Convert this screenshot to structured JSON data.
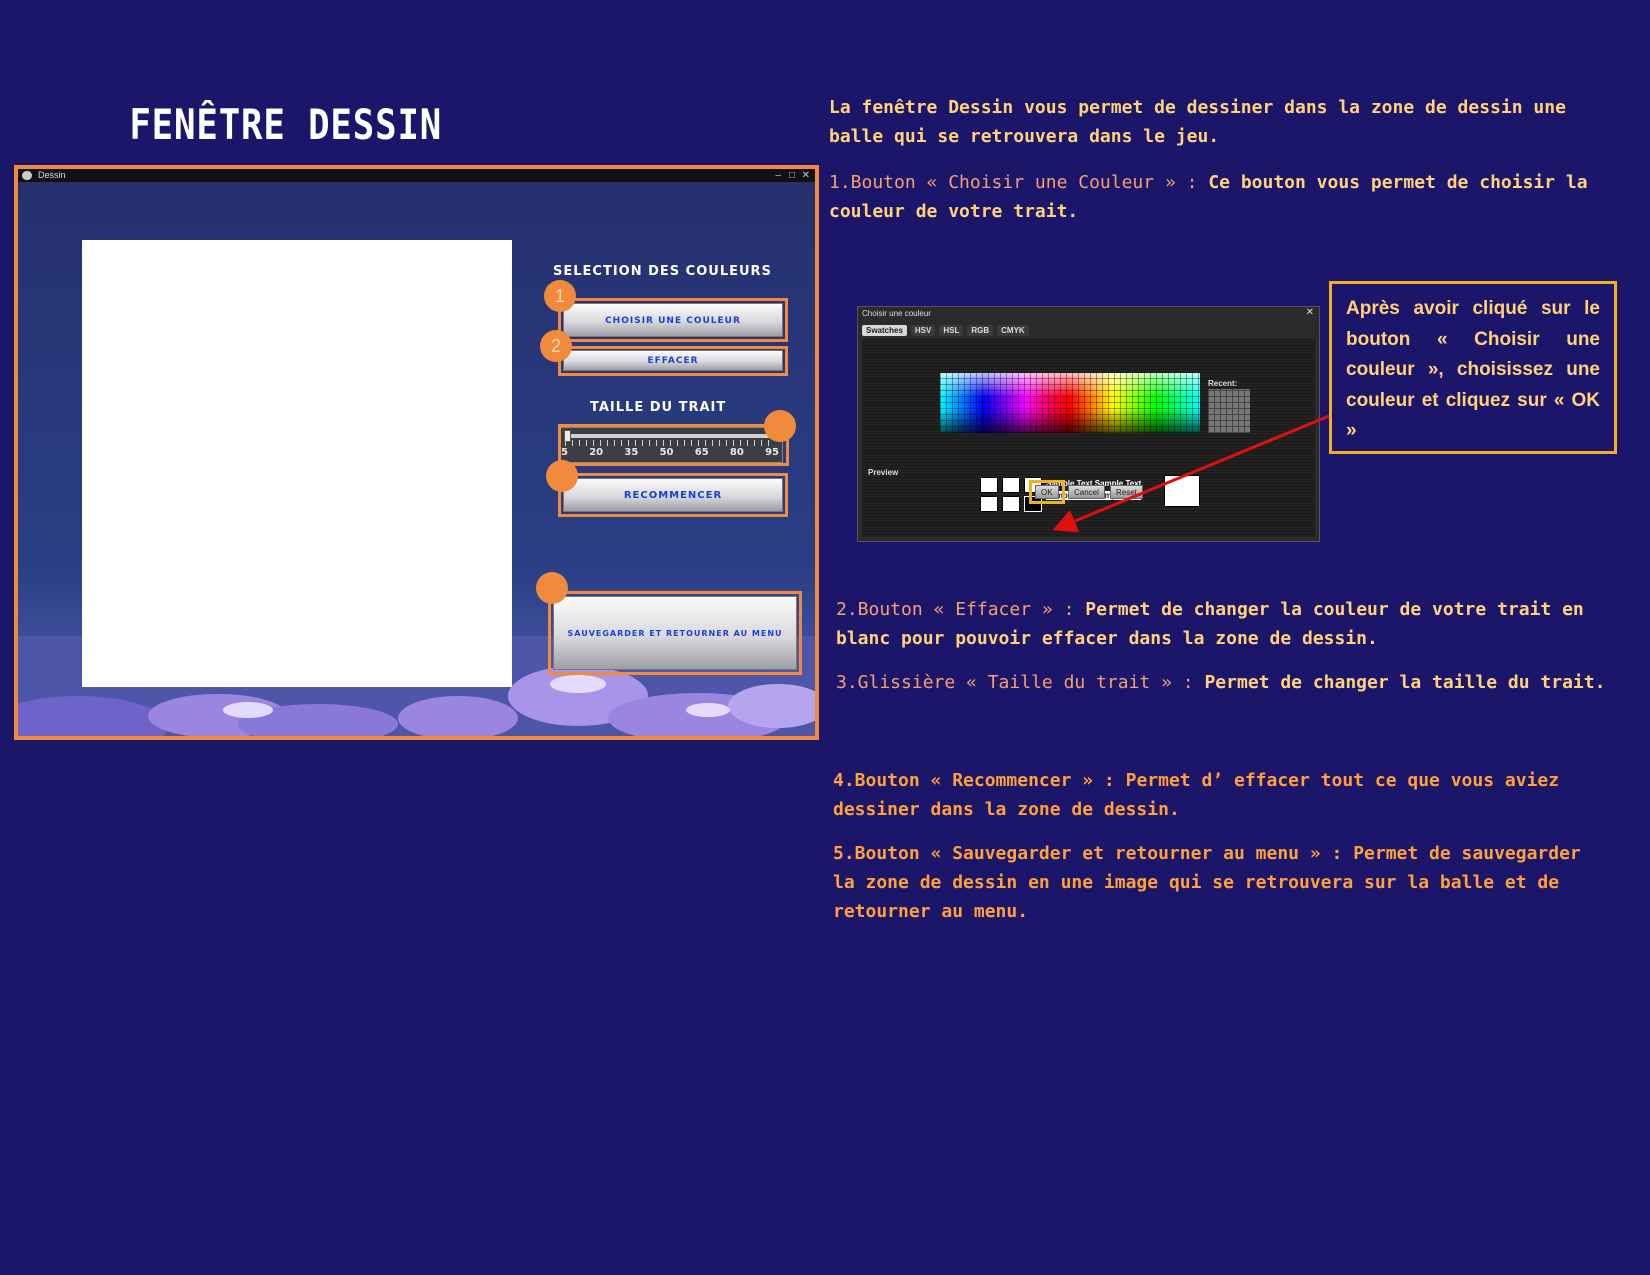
{
  "page": {
    "title": "FENÊTRE DESSIN"
  },
  "dessin_window": {
    "title": "Dessin",
    "controls": [
      "–",
      "□",
      "✕"
    ],
    "selection_label": "SELECTION DES COULEURS",
    "choose_color_button": "CHOISIR UNE COULEUR",
    "erase_button": "EFFACER",
    "stroke_size_label": "TAILLE DU TRAIT",
    "slider_ticks": [
      "5",
      "20",
      "35",
      "50",
      "65",
      "80",
      "95"
    ],
    "slider_value": 5,
    "restart_button": "RECOMMENCER",
    "save_button": "SAUVEGARDER ET RETOURNER AU MENU",
    "markers": [
      "1",
      "2",
      "",
      "",
      ""
    ]
  },
  "intro": "La fenêtre Dessin vous permet de dessiner dans la zone de dessin une balle qui se retrouvera dans le jeu.",
  "items": [
    {
      "label": "1.Bouton « Choisir une Couleur » :",
      "text": "Ce bouton vous permet de choisir la couleur de votre trait."
    },
    {
      "label": "2.Bouton « Effacer » :",
      "text": "Permet de changer la couleur de votre trait en blanc pour pouvoir effacer dans la zone de dessin."
    },
    {
      "label": "3.Glissière « Taille du trait » :",
      "text": "Permet de changer la taille du trait."
    },
    {
      "label": "4.Bouton « Recommencer » :",
      "text": "Permet d’ effacer tout ce que vous aviez dessiner dans la zone de dessin."
    },
    {
      "label": "5.Bouton « Sauvegarder et retourner au menu » :",
      "text": "Permet de sauvegarder la zone de dessin en une image qui se retrouvera sur la balle et de retourner au menu."
    }
  ],
  "color_chooser": {
    "title": "Choisir une couleur",
    "close": "✕",
    "tabs": [
      "Swatches",
      "HSV",
      "HSL",
      "RGB",
      "CMYK"
    ],
    "active_tab": "Swatches",
    "recent_label": "Recent:",
    "preview_label": "Preview",
    "sample_text": "Sample Text  Sample Text",
    "buttons": [
      "OK",
      "Cancel",
      "Reset"
    ]
  },
  "callout": "Après avoir cliqué sur le bouton « Choisir une couleur », choisissez une couleur et cliquez sur « OK »",
  "colors": {
    "background": "#1c166b",
    "accent_orange": "#f08a3c",
    "text_yellow": "#ffd27a",
    "highlight": "#f0b020",
    "arrow": "#e01010"
  }
}
